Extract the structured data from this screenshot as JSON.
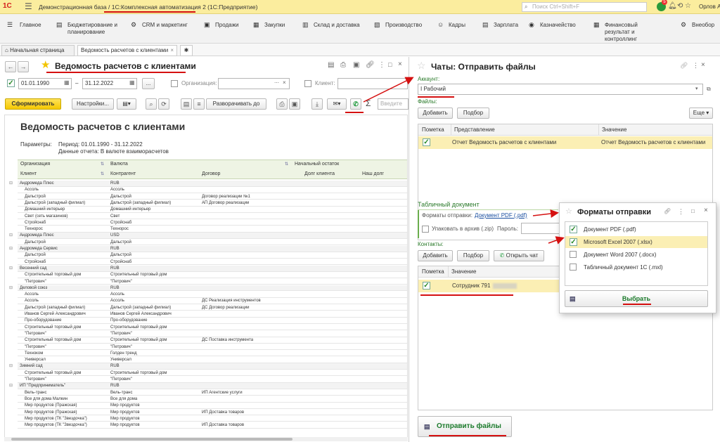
{
  "titlebar": {
    "title": "Демонстрационная база / 1С:Комплексная автоматизация 2  (1С:Предприятие)",
    "search_placeholder": "Поиск Ctrl+Shift+F",
    "notif_count": "5",
    "user": "Орлов А"
  },
  "sections": [
    "Главное",
    "Бюджетирование и планирование",
    "CRM и маркетинг",
    "Продажи",
    "Закупки",
    "Склад и доставка",
    "Производство",
    "Кадры",
    "Зарплата",
    "Казначейство",
    "Финансовый результат и контроллинг",
    "Внеобор"
  ],
  "tabs": {
    "home": "Начальная страница",
    "report": "Ведомость расчетов с клиентами"
  },
  "report": {
    "title": "Ведомость расчетов с клиентами",
    "date_from": "01.01.1990",
    "date_to": "31.12.2022",
    "dash": "–",
    "org_label": "Организация:",
    "client_label": "Клиент:",
    "btn_generate": "Сформировать",
    "btn_settings": "Настройки...",
    "btn_expand": "Разворачивать до",
    "search_placeholder": "Введите",
    "heading": "Ведомость расчетов с клиентами",
    "params_label": "Параметры:",
    "params_line1": "Период: 01.01.1990 - 31.12.2022",
    "params_line2": "Данные отчета: В валюте взаиморасчетов",
    "col_org": "Организация",
    "col_currency": "Валюта",
    "col_opening": "Начальный остаток",
    "col_client": "Клиент",
    "col_counterparty": "Контрагент",
    "col_contract": "Договор",
    "col_client_debt": "Долг клиента",
    "col_our_debt": "Наш долг",
    "rows": [
      {
        "a": "Андромеда Плюс",
        "b": "RUB",
        "c": "",
        "g": 1
      },
      {
        "a": "Ассоль",
        "b": "Ассоль",
        "c": "",
        "g": 0
      },
      {
        "a": "Дальстрой",
        "b": "Дальстрой",
        "c": "Договор реализации №1",
        "g": 0
      },
      {
        "a": "Дальстрой (западный филиал)",
        "b": "Дальстрой (западный филиал)",
        "c": "АП Договор реализации",
        "g": 0
      },
      {
        "a": "Домашний интерьер",
        "b": "Домашний интерьер",
        "c": "",
        "g": 0
      },
      {
        "a": "Свет (сеть магазинов)",
        "b": "Свет",
        "c": "",
        "g": 0
      },
      {
        "a": "Стройснаб",
        "b": "Стройснаб",
        "c": "",
        "g": 0
      },
      {
        "a": "Технорос",
        "b": "Технорос",
        "c": "",
        "g": 0
      },
      {
        "a": "Андромеда Плюс",
        "b": "USD",
        "c": "",
        "g": 1
      },
      {
        "a": "Дальстрой",
        "b": "Дальстрой",
        "c": "",
        "g": 0
      },
      {
        "a": "Андромеда Сервис",
        "b": "RUB",
        "c": "",
        "g": 1
      },
      {
        "a": "Дальстрой",
        "b": "Дальстрой",
        "c": "",
        "g": 0
      },
      {
        "a": "Стройснаб",
        "b": "Стройснаб",
        "c": "",
        "g": 0
      },
      {
        "a": "Весенний сад",
        "b": "RUB",
        "c": "",
        "g": 1
      },
      {
        "a": "Строительный торговый дом",
        "b": "Строительный торговый дом",
        "c": "",
        "g": 0
      },
      {
        "a": "\"Петрович\"",
        "b": "\"Петрович\"",
        "c": "",
        "g": 0
      },
      {
        "a": "Деловой союз",
        "b": "RUB",
        "c": "",
        "g": 1
      },
      {
        "a": "Ассоль",
        "b": "Ассоль",
        "c": "",
        "g": 0
      },
      {
        "a": "Ассоль",
        "b": "Ассоль",
        "c": "ДС Реализация инструментов",
        "g": 0
      },
      {
        "a": "Дальстрой (западный филиал)",
        "b": "Дальстрой (западный филиал)",
        "c": "ДС Договор реализации",
        "g": 0
      },
      {
        "a": "Иванов Сергей Александрович",
        "b": "Иванов Сергей Александрович",
        "c": "",
        "g": 0
      },
      {
        "a": "Про-оборудование",
        "b": "Про-оборудование",
        "c": "",
        "g": 0
      },
      {
        "a": "Строительный торговый дом",
        "b": "Строительный торговый дом",
        "c": "",
        "g": 0
      },
      {
        "a": "\"Петрович\"",
        "b": "\"Петрович\"",
        "c": "",
        "g": 0
      },
      {
        "a": "Строительный торговый дом",
        "b": "Строительный торговый дом",
        "c": "ДС Поставка инструмента",
        "g": 0
      },
      {
        "a": "\"Петрович\"",
        "b": "\"Петрович\"",
        "c": "",
        "g": 0
      },
      {
        "a": "Техноком",
        "b": "Голден тренд",
        "c": "",
        "g": 0
      },
      {
        "a": "Универсал",
        "b": "Универсал",
        "c": "",
        "g": 0
      },
      {
        "a": "Зимний сад",
        "b": "RUB",
        "c": "",
        "g": 1
      },
      {
        "a": "Строительный торговый дом",
        "b": "Строительный торговый дом",
        "c": "",
        "g": 0
      },
      {
        "a": "\"Петрович\"",
        "b": "\"Петрович\"",
        "c": "",
        "g": 0
      },
      {
        "a": "ИП \"Предприниматель\"",
        "b": "RUB",
        "c": "",
        "g": 1
      },
      {
        "a": "Вель-транс",
        "b": "Вель-транс",
        "c": "ИП Агентские услуги",
        "g": 0
      },
      {
        "a": "Все для дома Малкин",
        "b": "Все для дома",
        "c": "",
        "g": 0
      },
      {
        "a": "Мир продуктов (Пражская)",
        "b": "Мир продуктов",
        "c": "",
        "g": 0
      },
      {
        "a": "Мир продуктов (Пражская)",
        "b": "Мир продуктов",
        "c": "ИП Доставка товаров",
        "g": 0
      },
      {
        "a": "Мир продуктов (ТК \"Звездочка\")",
        "b": "Мир продуктов",
        "c": "",
        "g": 0
      },
      {
        "a": "Мир продуктов (ТК \"Звездочка\")",
        "b": "Мир продуктов",
        "c": "ИП Доставка товаров",
        "g": 0
      }
    ]
  },
  "chats": {
    "title": "Чаты: Отправить файлы",
    "account_label": "Аккаунт:",
    "account_value": "I Рабочий",
    "files_label": "Файлы:",
    "btn_add": "Добавить",
    "btn_pick": "Подбор",
    "btn_more": "Еще",
    "col_mark": "Пометка",
    "col_repr": "Представление",
    "col_value": "Значение",
    "file_row_repr": "Отчет Ведомость расчетов с клиентами",
    "file_row_value": "Отчет Ведомость расчетов с клиентами",
    "tabular_label": "Табличный документ",
    "formats_label": "Форматы отправки:",
    "formats_value": "Документ PDF (.pdf)",
    "zip_label": "Упаковать в архив (.zip)",
    "password_label": "Пароль:",
    "contacts_label": "Контакты:",
    "btn_add2": "Добавить",
    "btn_pick2": "Подбор",
    "btn_open_chat": "Открыть чат",
    "col_mark2": "Пометка",
    "col_value2": "Значение",
    "contact_row": "Сотрудник 791",
    "btn_send": "Отправить файлы"
  },
  "formats": {
    "title": "Форматы отправки",
    "options": [
      {
        "label": "Документ PDF (.pdf)",
        "checked": true
      },
      {
        "label": "Microsoft Excel 2007 (.xlsx)",
        "checked": true
      },
      {
        "label": "Документ Word 2007 (.docx)",
        "checked": false
      },
      {
        "label": "Табличный документ 1С (.mxl)",
        "checked": false
      }
    ],
    "btn_select": "Выбрать"
  }
}
